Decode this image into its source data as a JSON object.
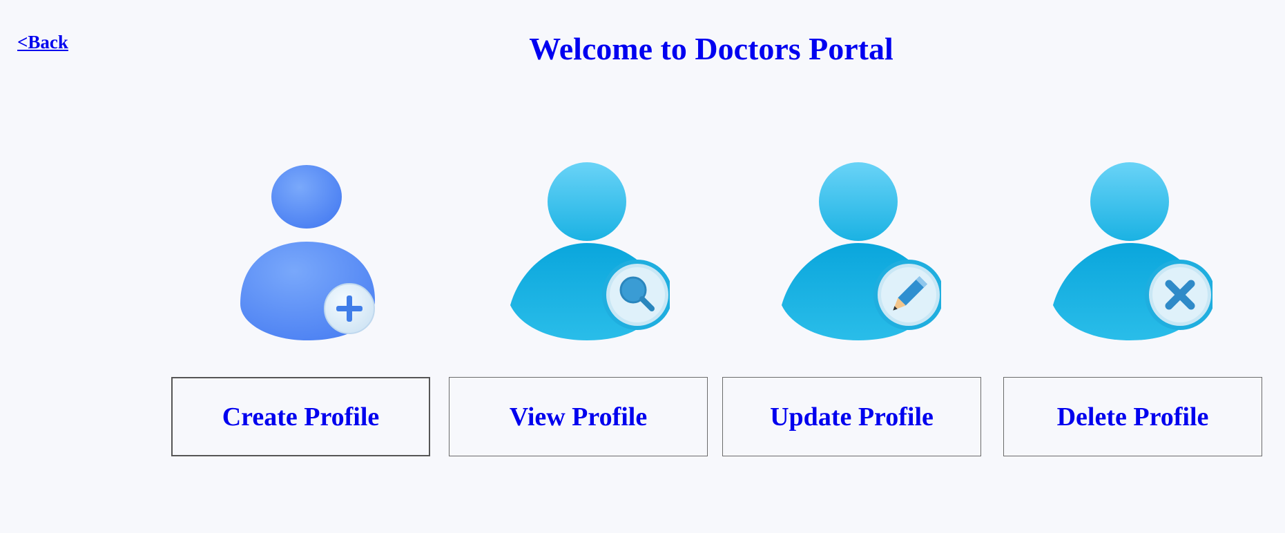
{
  "nav": {
    "back_label": "<Back"
  },
  "header": {
    "title": "Welcome to Doctors Portal"
  },
  "actions": [
    {
      "label": "Create Profile",
      "icon": "user-add-icon",
      "badge_icon": "plus-icon"
    },
    {
      "label": "View Profile",
      "icon": "user-search-icon",
      "badge_icon": "magnifier-icon"
    },
    {
      "label": "Update Profile",
      "icon": "user-edit-icon",
      "badge_icon": "pencil-icon"
    },
    {
      "label": "Delete Profile",
      "icon": "user-delete-icon",
      "badge_icon": "x-icon"
    }
  ],
  "colors": {
    "title": "#0000f0",
    "link": "#0000ee",
    "avatar_create": "#4f86f7",
    "avatar_other": "#1ab0e3",
    "background": "#f7f8fc"
  }
}
